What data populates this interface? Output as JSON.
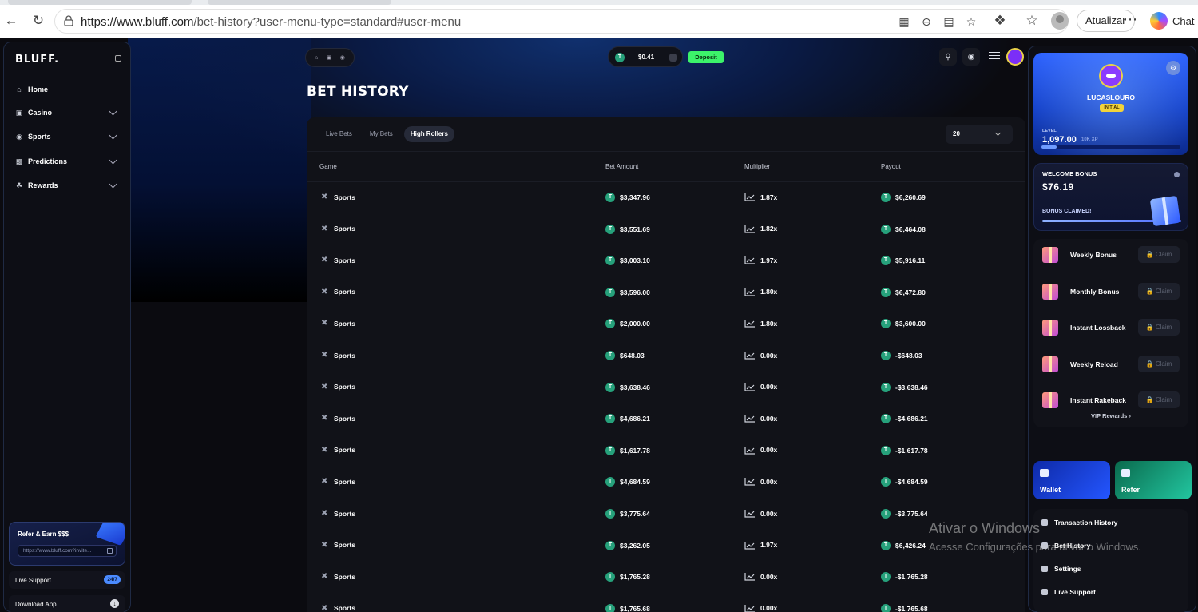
{
  "browser": {
    "url_host": "https://www.bluff.com",
    "url_path": "/bet-history?user-menu-type=standard#user-menu",
    "update_label": "Atualizar",
    "chat_label": "Chat"
  },
  "sidebar": {
    "logo": "BLUFF.",
    "items": [
      {
        "label": "Home",
        "icon": "home-icon",
        "expandable": false
      },
      {
        "label": "Casino",
        "icon": "casino-icon",
        "expandable": true
      },
      {
        "label": "Sports",
        "icon": "sports-icon",
        "expandable": true
      },
      {
        "label": "Predictions",
        "icon": "predictions-icon",
        "expandable": true
      },
      {
        "label": "Rewards",
        "icon": "rewards-icon",
        "expandable": true
      }
    ],
    "refer": {
      "title": "Refer & Earn $$$",
      "link": "https://www.bluff.com?invite..."
    },
    "live_support": {
      "label": "Live Support",
      "badge": "24/7"
    },
    "download": {
      "label": "Download App"
    }
  },
  "topbar": {
    "balance": "$0.41",
    "deposit_label": "Deposit"
  },
  "page": {
    "title": "BET HISTORY"
  },
  "table": {
    "tabs": [
      "Live Bets",
      "My Bets",
      "High Rollers"
    ],
    "active_tab": "High Rollers",
    "page_size": "20",
    "headers": {
      "game": "Game",
      "bet_amount": "Bet Amount",
      "multiplier": "Multiplier",
      "payout": "Payout"
    },
    "rows": [
      {
        "game": "Sports",
        "amount": "$3,347.96",
        "multiplier": "1.87x",
        "payout": "$6,260.69"
      },
      {
        "game": "Sports",
        "amount": "$3,551.69",
        "multiplier": "1.82x",
        "payout": "$6,464.08"
      },
      {
        "game": "Sports",
        "amount": "$3,003.10",
        "multiplier": "1.97x",
        "payout": "$5,916.11"
      },
      {
        "game": "Sports",
        "amount": "$3,596.00",
        "multiplier": "1.80x",
        "payout": "$6,472.80"
      },
      {
        "game": "Sports",
        "amount": "$2,000.00",
        "multiplier": "1.80x",
        "payout": "$3,600.00"
      },
      {
        "game": "Sports",
        "amount": "$648.03",
        "multiplier": "0.00x",
        "payout": "-$648.03"
      },
      {
        "game": "Sports",
        "amount": "$3,638.46",
        "multiplier": "0.00x",
        "payout": "-$3,638.46"
      },
      {
        "game": "Sports",
        "amount": "$4,686.21",
        "multiplier": "0.00x",
        "payout": "-$4,686.21"
      },
      {
        "game": "Sports",
        "amount": "$1,617.78",
        "multiplier": "0.00x",
        "payout": "-$1,617.78"
      },
      {
        "game": "Sports",
        "amount": "$4,684.59",
        "multiplier": "0.00x",
        "payout": "-$4,684.59"
      },
      {
        "game": "Sports",
        "amount": "$3,775.64",
        "multiplier": "0.00x",
        "payout": "-$3,775.64"
      },
      {
        "game": "Sports",
        "amount": "$3,262.05",
        "multiplier": "1.97x",
        "payout": "$6,426.24"
      },
      {
        "game": "Sports",
        "amount": "$1,765.28",
        "multiplier": "0.00x",
        "payout": "-$1,765.28"
      },
      {
        "game": "Sports",
        "amount": "$1,765.68",
        "multiplier": "0.00x",
        "payout": "-$1,765.68"
      }
    ]
  },
  "profile": {
    "username": "LUCASLOURO",
    "rank": "INITIAL",
    "level_label": "LEVEL",
    "xp": "1,097.00",
    "xp_max": "10K XP",
    "xp_progress": 0.11
  },
  "welcome_bonus": {
    "title": "WELCOME BONUS",
    "value": "$76.19",
    "status": "BONUS CLAIMED!"
  },
  "claims": [
    {
      "name": "Weekly Bonus",
      "button": "Claim"
    },
    {
      "name": "Monthly Bonus",
      "button": "Claim"
    },
    {
      "name": "Instant Lossback",
      "button": "Claim"
    },
    {
      "name": "Weekly Reload",
      "button": "Claim"
    },
    {
      "name": "Instant Rakeback",
      "button": "Claim"
    }
  ],
  "vip_label": "VIP Rewards",
  "tiles": {
    "wallet": "Wallet",
    "refer": "Refer"
  },
  "user_menu": [
    "Transaction History",
    "Bet History",
    "Settings",
    "Live Support"
  ],
  "os_watermark": {
    "line1": "Ativar o Windows",
    "line2": "Acesse Configurações para ativar o Windows."
  }
}
